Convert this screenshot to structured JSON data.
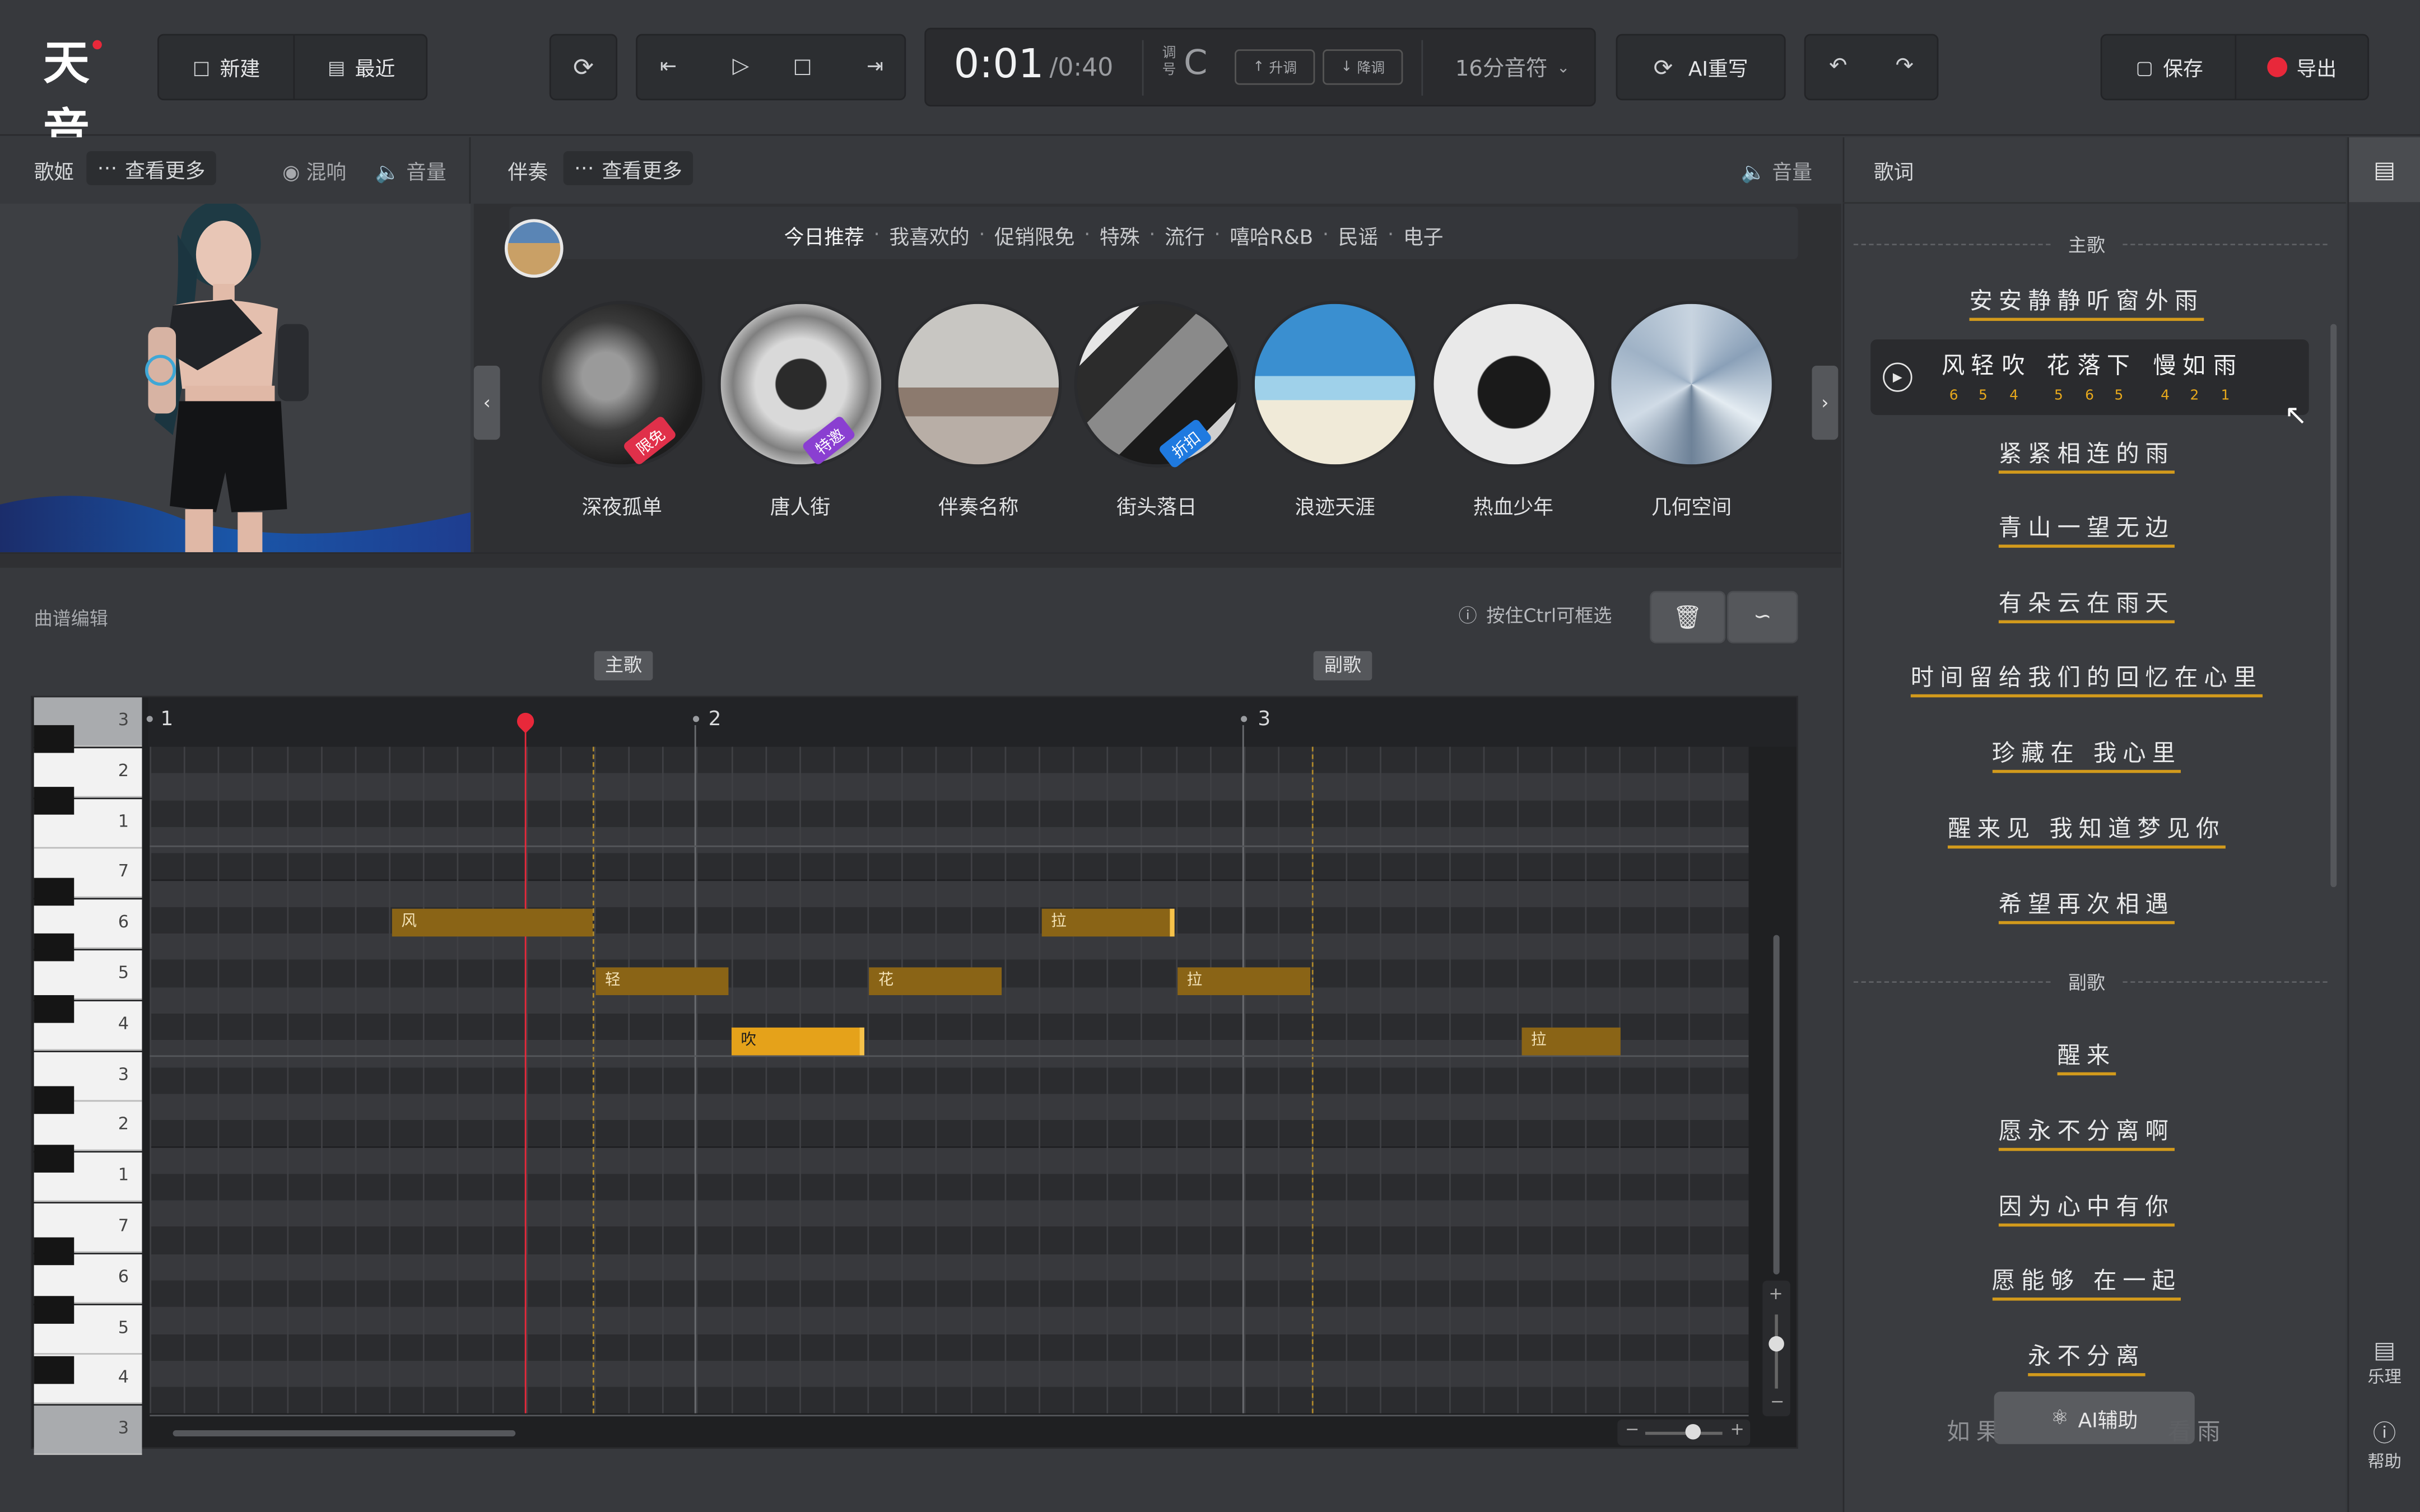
{
  "app": {
    "logo_text": "天音"
  },
  "toolbar": {
    "new_label": "新建",
    "recent_label": "最近",
    "time_current": "0:01",
    "time_total": "/0:40",
    "key_label": "调号",
    "key_value": "C",
    "raise_label": "升调",
    "lower_label": "降调",
    "note_unit": "16分音符",
    "ai_rewrite_label": "AI重写",
    "save_label": "保存",
    "export_label": "导出"
  },
  "singer_panel": {
    "title": "歌姬",
    "more_label": "查看更多",
    "reverb_label": "混响",
    "volume_label": "音量"
  },
  "accomp_panel": {
    "title": "伴奏",
    "more_label": "查看更多",
    "volume_label": "音量",
    "categories": [
      "今日推荐",
      "我喜欢的",
      "促销限免",
      "特殊",
      "流行",
      "嘻哈R&B",
      "民谣",
      "电子"
    ],
    "tracks": [
      {
        "name": "深夜孤单",
        "tag": "限免",
        "tag_color": "#e0304a"
      },
      {
        "name": "唐人街",
        "tag": "特邀",
        "tag_color": "#8a3fd1"
      },
      {
        "name": "伴奏名称",
        "tag": "",
        "tag_color": ""
      },
      {
        "name": "街头落日",
        "tag": "折扣",
        "tag_color": "#1f7ae0"
      },
      {
        "name": "浪迹天涯",
        "tag": "",
        "tag_color": ""
      },
      {
        "name": "热血少年",
        "tag": "",
        "tag_color": ""
      },
      {
        "name": "几何空间",
        "tag": "",
        "tag_color": ""
      }
    ]
  },
  "editor": {
    "title": "曲谱编辑",
    "hint": "按住Ctrl可框选",
    "section_labels": [
      "主歌",
      "副歌"
    ],
    "bar_numbers": [
      "1",
      "2",
      "3"
    ],
    "key_labels": [
      "3",
      "2",
      "1",
      "7",
      "6",
      "5",
      "4",
      "3",
      "2",
      "1",
      "7",
      "6",
      "5",
      "4",
      "3"
    ],
    "notes": [
      {
        "lyric": "风",
        "pitch": "6"
      },
      {
        "lyric": "轻",
        "pitch": "5"
      },
      {
        "lyric": "吹",
        "pitch": "4"
      },
      {
        "lyric": "花",
        "pitch": "5"
      },
      {
        "lyric": "拉",
        "pitch": "6"
      },
      {
        "lyric": "拉",
        "pitch": "5"
      },
      {
        "lyric": "拉",
        "pitch": "4"
      }
    ]
  },
  "lyrics_panel": {
    "title": "歌词",
    "verse_label": "主歌",
    "chorus_label": "副歌",
    "active_line": {
      "text": [
        "风",
        "轻",
        "吹",
        "花",
        "落",
        "下",
        "慢",
        "如",
        "雨"
      ],
      "numbers": [
        "6",
        "5",
        "4",
        "5",
        "6",
        "5",
        "4",
        "2",
        "1"
      ]
    },
    "verse_lines": [
      "安安静静听窗外雨",
      "紧紧相连的雨",
      "青山一望无边",
      "有朵云在雨天",
      "时间留给我们的回忆在心里",
      "珍藏在  我心里",
      "醒来见  我知道梦见你",
      "希望再次相遇"
    ],
    "chorus_lines": [
      "醒来",
      "愿永不分离啊",
      "因为心中有你",
      "愿能够 在一起",
      "永不分离",
      "如果            看雨"
    ],
    "ai_assist_label": "AI辅助"
  },
  "side_rail": {
    "score_label": "乐理",
    "help_label": "帮助"
  },
  "colors": {
    "accent": "#e8a91c",
    "note_active": "#e5a21a",
    "playhead": "#e8283a",
    "export_icon": "#e8283a"
  }
}
